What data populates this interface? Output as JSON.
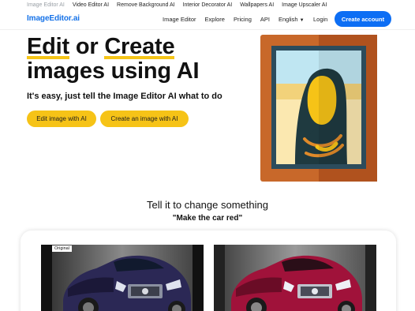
{
  "topbar": {
    "links": [
      "Image Editor AI",
      "Video Editor AI",
      "Remove Background AI",
      "Interior Decorator AI",
      "Wallpapers AI",
      "Image Upscaler AI"
    ]
  },
  "nav": {
    "logo": "ImageEditor.ai",
    "links": [
      "Image Editor",
      "Explore",
      "Pricing",
      "API"
    ],
    "language": "English",
    "login": "Login",
    "cta": "Create account"
  },
  "hero": {
    "title_word1": "Edit",
    "title_mid": " or ",
    "title_word2": "Create",
    "title_line2": "images using AI",
    "subtitle": "It's easy, just tell the Image Editor AI what to do",
    "btn_edit": "Edit image with AI",
    "btn_create": "Create an image with AI"
  },
  "demo": {
    "heading": "Tell it to change something",
    "prompt": "\"Make the car red\"",
    "original_label": "Original"
  },
  "colors": {
    "brand_blue": "#0d6ef4",
    "accent_yellow": "#f6c317",
    "frame_orange": "#c8682a"
  }
}
